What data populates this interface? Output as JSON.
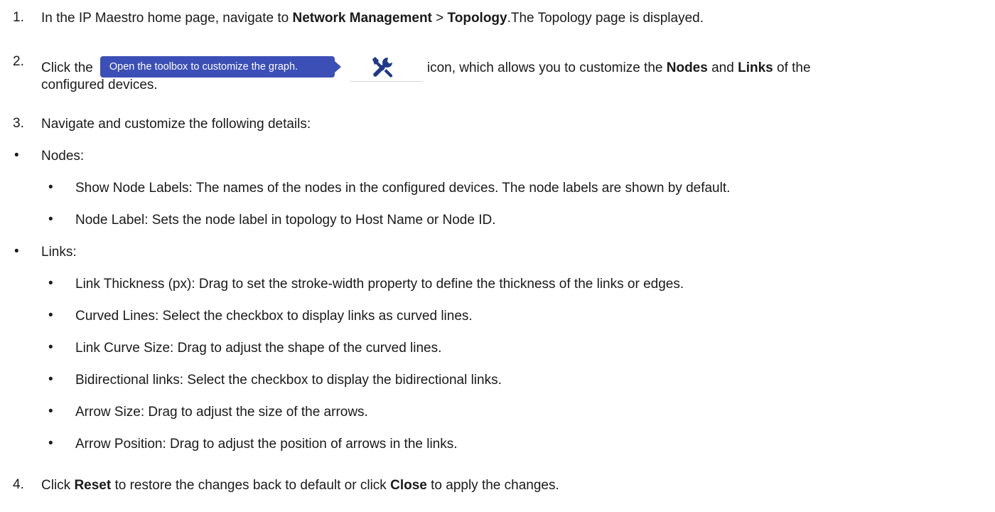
{
  "steps": {
    "s1": {
      "num": "1.",
      "pre": "In the IP Maestro home page, navigate to ",
      "b1": "Network Management",
      "mid": " > ",
      "b2": "Topology",
      "post": ".The Topology page is displayed."
    },
    "s2": {
      "num": "2.",
      "pre": "Click the",
      "tooltip": "Open the toolbox to customize the graph.",
      "icon": "tools-icon",
      "mid1": "icon, which allows you to customize the ",
      "b1": "Nodes",
      "mid2": " and ",
      "b2": "Links",
      "post": " of the",
      "cont": "configured devices."
    },
    "s3": {
      "num": "3.",
      "text": "Navigate and customize the following details:"
    },
    "nodes": {
      "heading": "Nodes:",
      "items": [
        "Show Node Labels: The names of the nodes in the configured devices. The node labels are shown by default.",
        "Node Label: Sets the node label in topology to Host Name or Node ID."
      ]
    },
    "links": {
      "heading": "Links:",
      "items": [
        "Link Thickness (px): Drag to set the stroke-width property to define the thickness of the links or edges.",
        "Curved Lines: Select the checkbox to display links as curved lines.",
        "Link Curve Size: Drag to adjust the shape of the curved lines.",
        "Bidirectional links: Select the checkbox to display the bidirectional links.",
        "Arrow Size: Drag to adjust the size of the arrows.",
        "Arrow Position: Drag to adjust the position of arrows in the links."
      ]
    },
    "s4": {
      "num": "4.",
      "pre": "Click ",
      "b1": "Reset",
      "mid": " to restore the changes back to default or click ",
      "b2": "Close",
      "post": " to apply the changes."
    }
  },
  "bullet_char": "•",
  "colors": {
    "tooltip_bg": "#3b4fb6",
    "icon": "#1f3a8a",
    "text": "#1a1a1a"
  }
}
